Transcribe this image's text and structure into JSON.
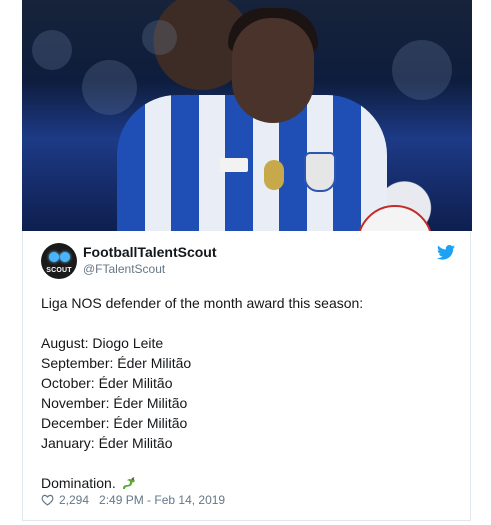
{
  "tweet": {
    "display_name": "FootballTalentScout",
    "handle": "@FTalentScout",
    "avatar_text": "SCOUT",
    "lines": [
      "Liga NOS defender of the month award this season:",
      "",
      "August: Diogo Leite",
      "September: Éder Militão",
      "October: Éder Militão",
      "November: Éder Militão",
      "December: Éder Militão",
      "January: Éder Militão",
      "",
      "Domination."
    ],
    "likes": "2,294",
    "timestamp": "2:49 PM - Feb 14, 2019"
  },
  "icons": {
    "platform": "twitter-bird-icon",
    "like": "heart-icon",
    "emoji": "dragon-icon"
  },
  "colors": {
    "twitter_blue": "#1da1f2",
    "muted": "#657786",
    "text": "#14171a"
  }
}
